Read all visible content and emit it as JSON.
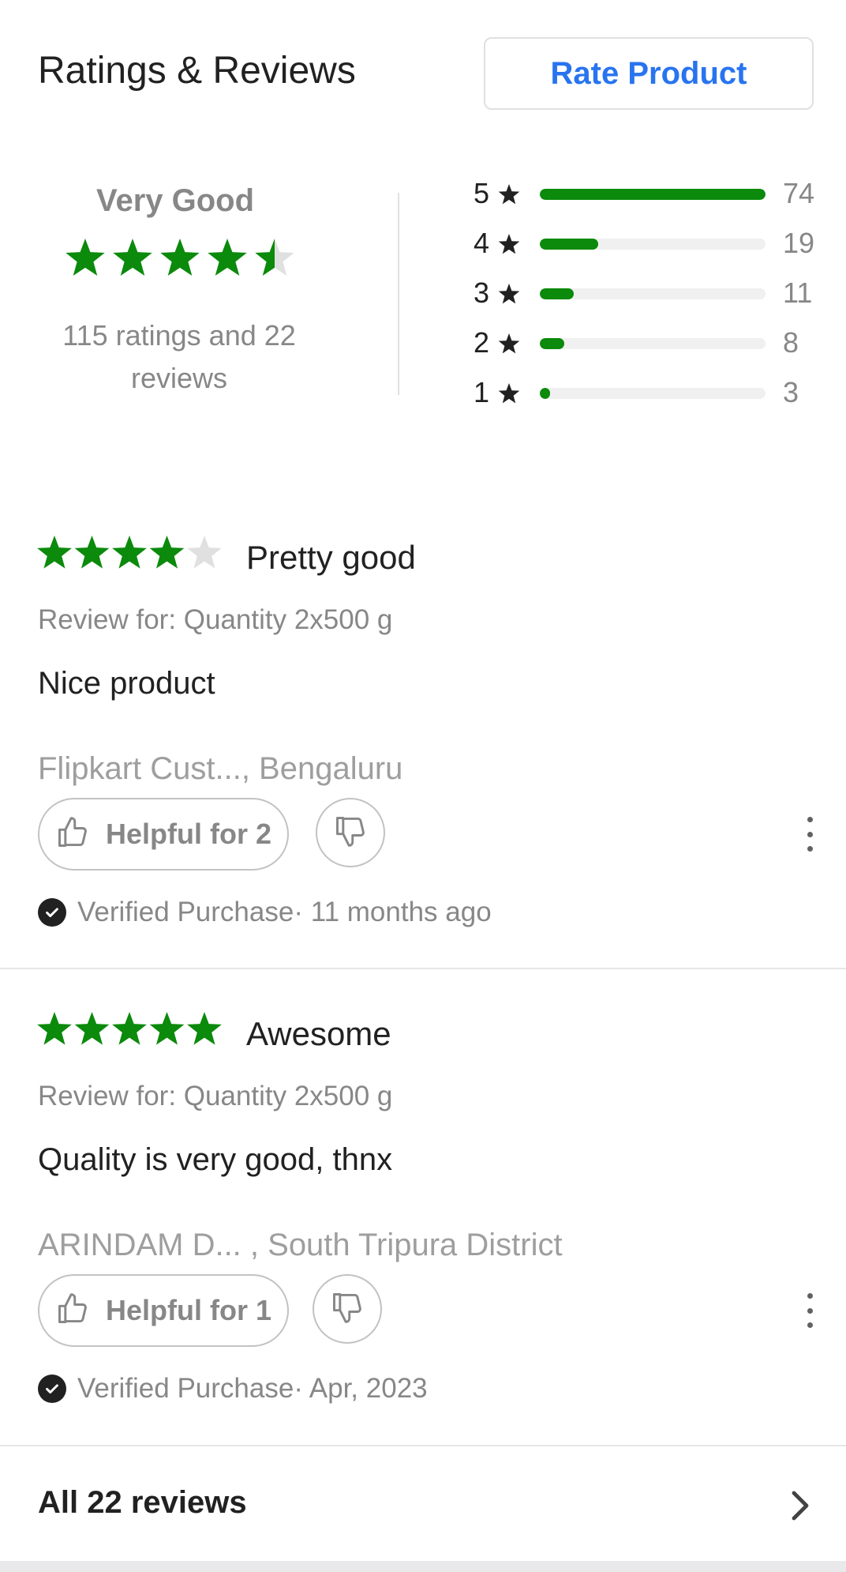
{
  "header": {
    "title": "Ratings & Reviews",
    "rate_button": "Rate Product"
  },
  "colors": {
    "accent_blue": "#2874f0",
    "star_green": "#0b8a0b",
    "muted_gray": "#878787"
  },
  "summary": {
    "label": "Very Good",
    "average_rating": 4.5,
    "counts_text": "115 ratings and 22 reviews",
    "distribution": [
      {
        "stars": "5",
        "count": "74",
        "fraction": 0.64
      },
      {
        "stars": "4",
        "count": "19",
        "fraction": 0.165
      },
      {
        "stars": "3",
        "count": "11",
        "fraction": 0.096
      },
      {
        "stars": "2",
        "count": "8",
        "fraction": 0.07
      },
      {
        "stars": "1",
        "count": "3",
        "fraction": 0.026
      }
    ]
  },
  "reviews": [
    {
      "rating": 4,
      "title": "Pretty good",
      "review_for": "Review for: Quantity 2x500 g",
      "text": "Nice product",
      "author": "Flipkart Cust..., Bengaluru",
      "helpful_label": "Helpful for 2",
      "verified": "Verified Purchase· 11 months ago"
    },
    {
      "rating": 5,
      "title": "Awesome",
      "review_for": "Review for: Quantity 2x500 g",
      "text": "Quality is very good, thnx",
      "author": "ARINDAM D... , South Tripura District",
      "helpful_label": "Helpful for 1",
      "verified": "Verified Purchase· Apr, 2023"
    }
  ],
  "footer": {
    "all_reviews_label": "All 22 reviews"
  },
  "icons": {
    "star": "star-icon",
    "thumbs_up": "thumbs-up-icon",
    "thumbs_down": "thumbs-down-icon",
    "more": "more-vertical-icon",
    "check": "check-circle-icon",
    "chevron": "chevron-right-icon"
  }
}
